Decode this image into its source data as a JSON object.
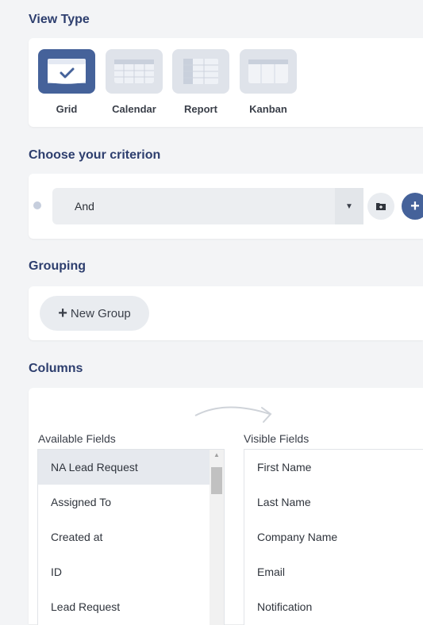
{
  "view_type": {
    "title": "View Type",
    "options": [
      {
        "label": "Grid",
        "icon": "grid-view-icon",
        "active": true
      },
      {
        "label": "Calendar",
        "icon": "calendar-view-icon",
        "active": false
      },
      {
        "label": "Report",
        "icon": "report-view-icon",
        "active": false
      },
      {
        "label": "Kanban",
        "icon": "kanban-view-icon",
        "active": false
      }
    ]
  },
  "criterion": {
    "title": "Choose your criterion",
    "operator": "And"
  },
  "grouping": {
    "title": "Grouping",
    "new_group_label": "New Group"
  },
  "columns": {
    "title": "Columns",
    "available_label": "Available Fields",
    "visible_label": "Visible Fields",
    "available_fields": [
      "NA Lead Request",
      "Assigned To",
      "Created at",
      "ID",
      "Lead Request"
    ],
    "visible_fields": [
      "First Name",
      "Last Name",
      "Company Name",
      "Email",
      "Notification"
    ]
  },
  "colors": {
    "accent": "#45629a",
    "heading": "#2d3e6e",
    "tile_inactive": "#dfe3ea",
    "background": "#f3f4f6"
  }
}
